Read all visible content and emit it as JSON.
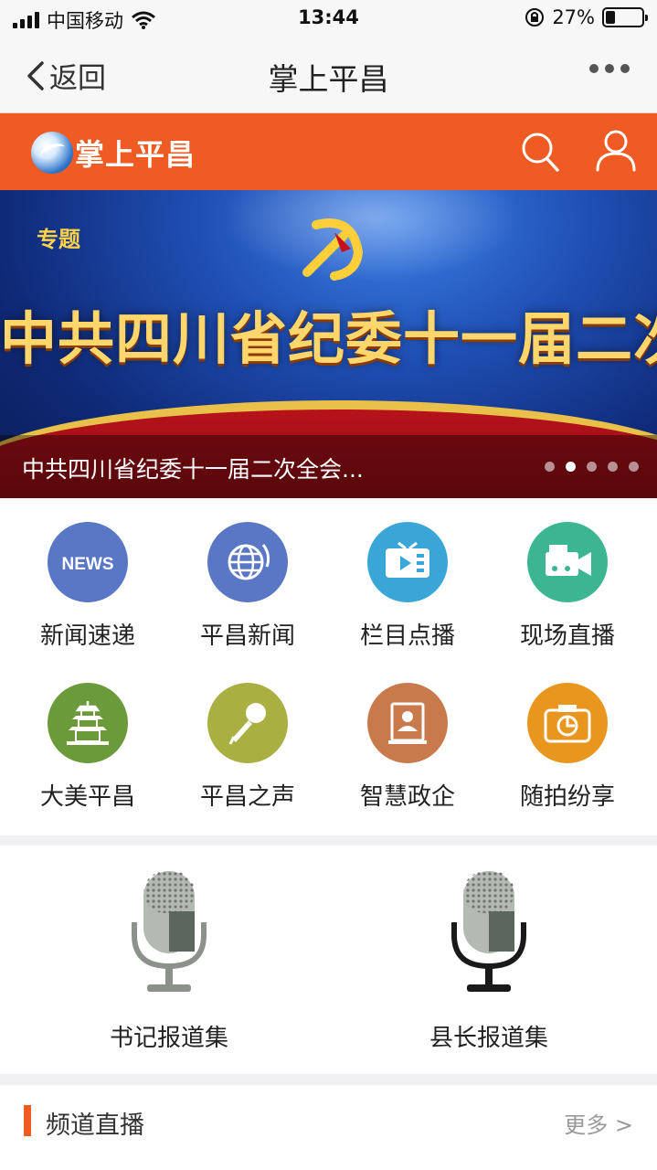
{
  "status_bar": {
    "carrier": "中国移动",
    "time": "13:44",
    "battery": "27%",
    "battery_level": 0.27
  },
  "nav": {
    "back_label": "返回",
    "title": "掌上平昌"
  },
  "header": {
    "logo_text": "掌上平昌",
    "icons": [
      "search-icon",
      "user-icon"
    ]
  },
  "banner": {
    "tag": "专题",
    "headline": "中共四川省纪委十一届二次全会",
    "caption": "中共四川省纪委十一届二次全会...",
    "slide_count": 5,
    "active_slide": 2
  },
  "grid": {
    "items": [
      {
        "label": "新闻速递",
        "icon": "news-icon",
        "color": "#5a77c6"
      },
      {
        "label": "平昌新闻",
        "icon": "globe-icon",
        "color": "#5a77c6"
      },
      {
        "label": "栏目点播",
        "icon": "tv-play-icon",
        "color": "#3aa6d8"
      },
      {
        "label": "现场直播",
        "icon": "video-camera-icon",
        "color": "#3bb592"
      },
      {
        "label": "大美平昌",
        "icon": "pagoda-icon",
        "color": "#6a9a3a"
      },
      {
        "label": "平昌之声",
        "icon": "microphone-icon",
        "color": "#a9b041"
      },
      {
        "label": "智慧政企",
        "icon": "portrait-frame-icon",
        "color": "#c97a4c"
      },
      {
        "label": "随拍纷享",
        "icon": "camera-icon",
        "color": "#e8961e"
      }
    ]
  },
  "reports": [
    {
      "label": "书记报道集",
      "icon": "microphone-icon"
    },
    {
      "label": "县长报道集",
      "icon": "microphone-icon"
    }
  ],
  "channel": {
    "title": "频道直播",
    "more_label": "更多 >"
  },
  "colors": {
    "brand": "#f05a23",
    "background": "#f0f0f3"
  }
}
